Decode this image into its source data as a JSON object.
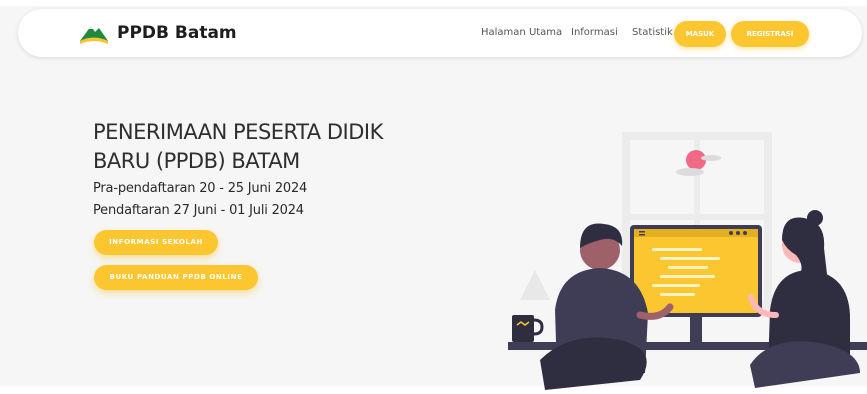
{
  "brand": {
    "name": "PPDB Batam",
    "logo_icon": "mountain-logo-icon"
  },
  "nav": {
    "links": [
      "Halaman Utama",
      "Informasi",
      "Statistik"
    ],
    "login_label": "MASUK",
    "register_label": "REGISTRASI"
  },
  "hero": {
    "title_line1": "PENERIMAAN PESERTA DIDIK",
    "title_line2": "BARU (PPDB) BATAM",
    "pre_registration": "Pra-pendaftaran 20 - 25 Juni 2024",
    "registration": "Pendaftaran 27 Juni - 01 Juli 2024",
    "btn_school_info": "INFORMASI SEKOLAH",
    "btn_guide": "BUKU PANDUAN PPDB ONLINE"
  },
  "colors": {
    "accent": "#fcc630",
    "text": "#2e2e2e",
    "background": "#f7f6f6",
    "logo_green": "#1f8a3e"
  }
}
